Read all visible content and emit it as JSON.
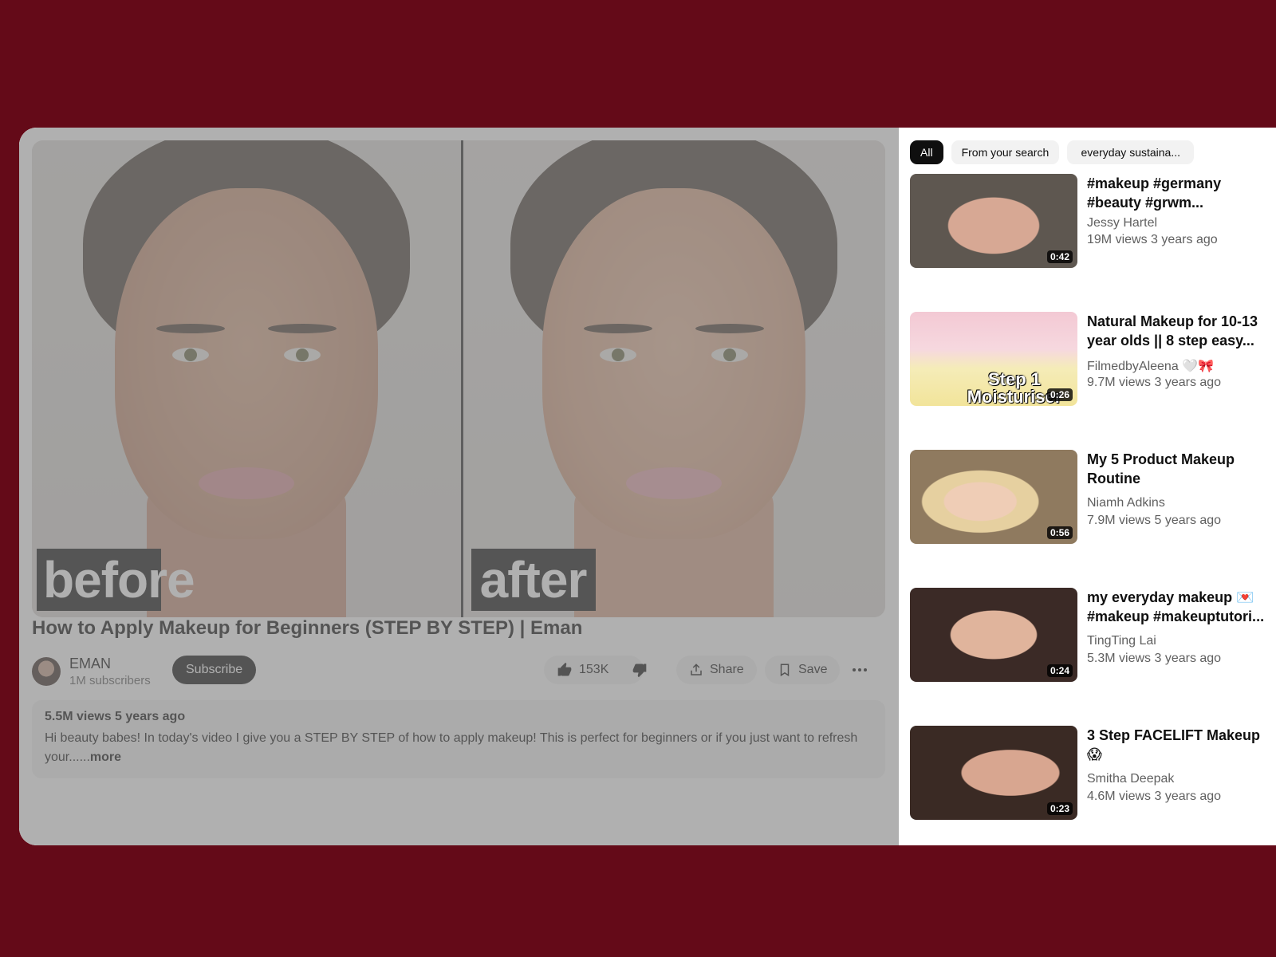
{
  "video": {
    "overlay_left": "before",
    "overlay_right": "after",
    "title": "How to Apply Makeup for Beginners (STEP BY STEP) | Eman"
  },
  "channel": {
    "name": "EMAN",
    "subscribers": "1M subscribers",
    "subscribe_label": "Subscribe"
  },
  "actions": {
    "likes": "153K",
    "share_label": "Share",
    "save_label": "Save"
  },
  "description": {
    "meta": "5.5M views 5 years ago",
    "text": "Hi beauty babes! In today's video I give you a STEP BY STEP of how to apply makeup! This is perfect for beginners or if you just want to refresh your......",
    "more_label": "more"
  },
  "chips": [
    {
      "label": "All"
    },
    {
      "label": "From your search"
    },
    {
      "label": "everyday sustaina..."
    }
  ],
  "recommendations": [
    {
      "title": "#makeup #germany #beauty #grwm...",
      "channel": "Jessy Hartel",
      "meta": "19M views 3 years ago",
      "duration": "0:42",
      "caption": ""
    },
    {
      "title": "Natural Makeup for 10-13 year olds || 8 step easy...",
      "channel": "FilmedbyAleena 🤍🎀",
      "meta": "9.7M views 3 years ago",
      "duration": "0:26",
      "caption": "Step 1 Moisturiser"
    },
    {
      "title": "My 5 Product Makeup Routine",
      "channel": "Niamh Adkins",
      "meta": "7.9M views 5 years ago",
      "duration": "0:56",
      "caption": ""
    },
    {
      "title": "my everyday makeup 💌 #makeup #makeuptutori...",
      "channel": "TingTing Lai",
      "meta": "5.3M views 3 years ago",
      "duration": "0:24",
      "caption": ""
    },
    {
      "title": "3 Step FACELIFT Makeup 😱",
      "channel": "Smitha Deepak",
      "meta": "4.6M views 3 years ago",
      "duration": "0:23",
      "caption": ""
    }
  ],
  "colors": {
    "page_background": "#640a18",
    "primary_text": "#0f0f0f",
    "secondary_text": "#606060",
    "chip_background": "#f2f2f2"
  },
  "icons": [
    "like-icon",
    "dislike-icon",
    "share-icon",
    "save-icon",
    "more-icon"
  ]
}
